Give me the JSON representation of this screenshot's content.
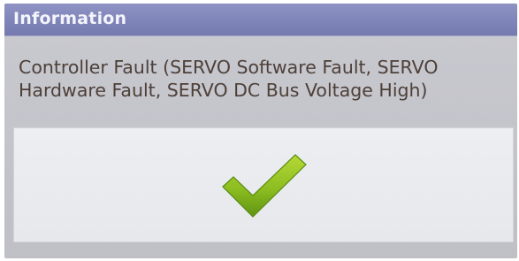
{
  "dialog": {
    "title": "Information",
    "message_lines": [
      "Controller Fault (SERVO Software Fault, SERVO",
      "Hardware Fault, SERVO DC Bus Voltage High)"
    ],
    "status_icon": "checkmark-icon",
    "colors": {
      "titlebar": "#7f84b9",
      "title_text": "#f4f4fb",
      "body": "#c4c4cb",
      "message_text": "#4d4038",
      "panel": "#e8eaee",
      "check_light": "#a6cf2a",
      "check_dark": "#5f9412"
    }
  }
}
